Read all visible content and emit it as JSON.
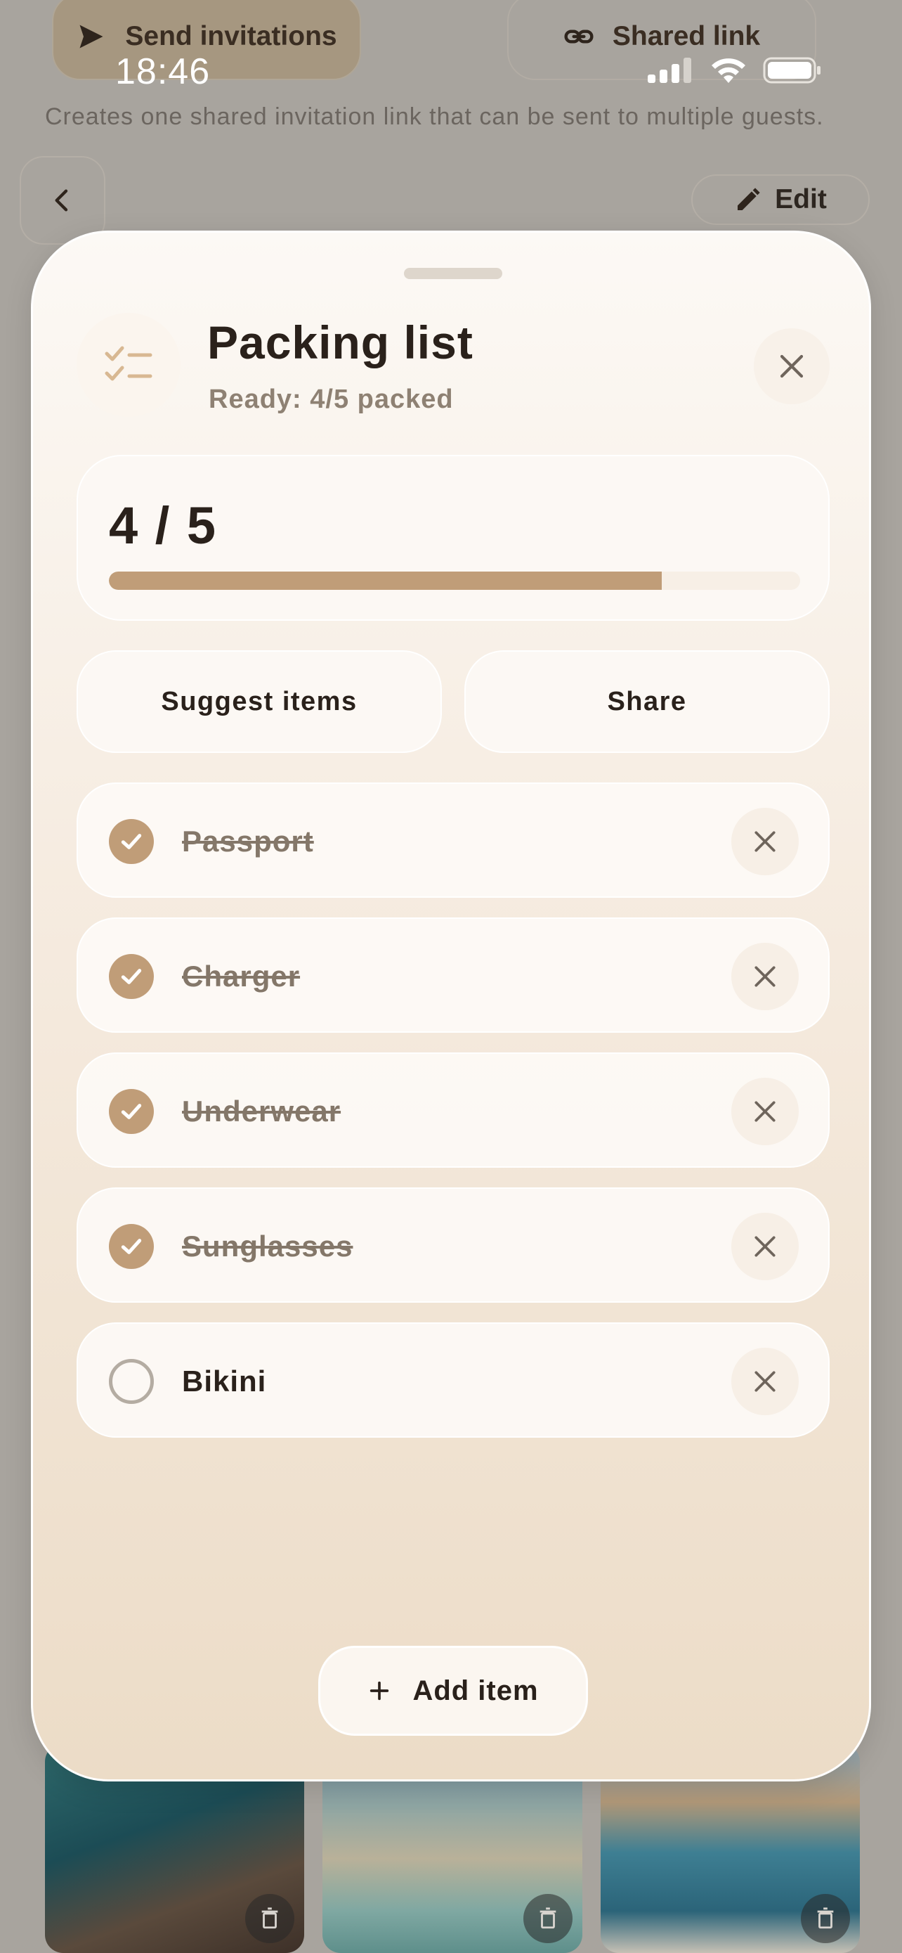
{
  "status_bar": {
    "time": "18:46"
  },
  "background": {
    "send_invitations_label": "Send invitations",
    "shared_link_label": "Shared link",
    "description": "Creates one shared invitation link that can be sent to multiple guests.",
    "edit_label": "Edit"
  },
  "sheet": {
    "title": "Packing list",
    "subtitle": "Ready: 4/5 packed",
    "progress": {
      "text": "4 / 5",
      "packed": 4,
      "total": 5,
      "fraction": 0.8
    },
    "actions": {
      "suggest_label": "Suggest items",
      "share_label": "Share"
    },
    "items": [
      {
        "label": "Passport",
        "checked": true
      },
      {
        "label": "Charger",
        "checked": true
      },
      {
        "label": "Underwear",
        "checked": true
      },
      {
        "label": "Sunglasses",
        "checked": true
      },
      {
        "label": "Bikini",
        "checked": false
      }
    ],
    "add_item_label": "Add item"
  },
  "colors": {
    "accent": "#c09d78",
    "text_primary": "#2a211b",
    "text_muted": "#8e8173"
  },
  "icons": {
    "send": "paper-plane-icon",
    "link": "link-icon",
    "back": "chevron-left-icon",
    "edit": "pencil-icon",
    "list": "checklist-icon",
    "close": "close-icon",
    "check": "checkmark-icon",
    "delete": "x-icon",
    "add": "plus-icon",
    "trash": "trash-icon"
  }
}
